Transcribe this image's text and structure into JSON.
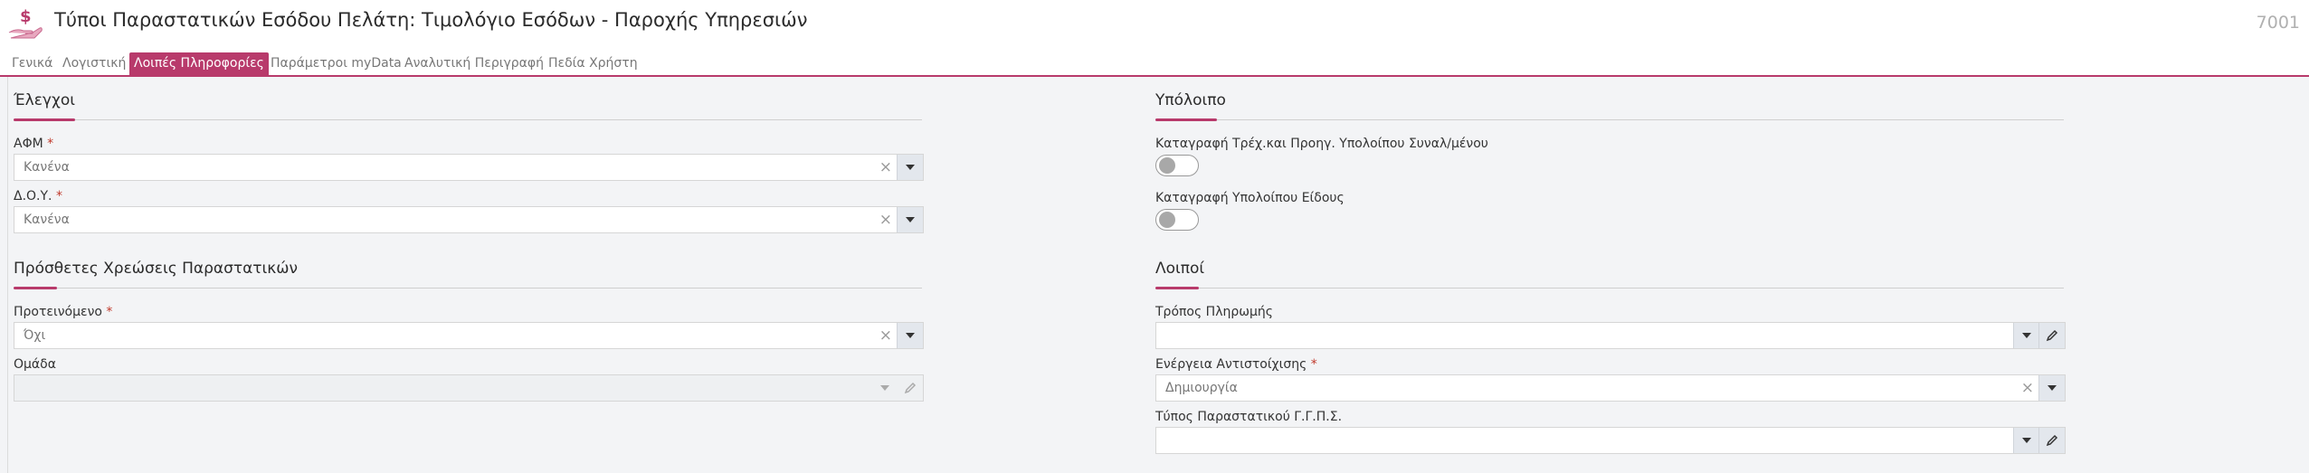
{
  "header": {
    "title": "Τύποι Παραστατικών Εσόδου Πελάτη: Τιμολόγιο Εσόδων - Παροχής Υπηρεσιών",
    "code": "7001",
    "icon": "hand-holding-dollar-icon"
  },
  "tabs": [
    {
      "label": "Γενικά",
      "active": false
    },
    {
      "label": "Λογιστική",
      "active": false
    },
    {
      "label": "Λοιπές Πληροφορίες",
      "active": true
    },
    {
      "label": "Παράμετροι myData",
      "active": false
    },
    {
      "label": "Αναλυτική Περιγραφή",
      "active": false
    },
    {
      "label": "Πεδία Χρήστη",
      "active": false
    }
  ],
  "left": {
    "checks": {
      "title": "Έλεγχοι",
      "afm": {
        "label": "ΑΦΜ",
        "required": "*",
        "value": "Κανένα"
      },
      "doy": {
        "label": "Δ.Ο.Υ.",
        "required": "*",
        "value": "Κανένα"
      }
    },
    "charges": {
      "title": "Πρόσθετες Χρεώσεις Παραστατικών",
      "suggested": {
        "label": "Προτεινόμενο",
        "required": "*",
        "value": "Όχι"
      },
      "group": {
        "label": "Ομάδα",
        "value": ""
      }
    }
  },
  "right": {
    "balance": {
      "title": "Υπόλοιπο",
      "toggle1": {
        "label": "Καταγραφή Τρέχ.και Προηγ. Υπολοίπου Συναλ/μένου",
        "on": false
      },
      "toggle2": {
        "label": "Καταγραφή Υπολοίπου Είδους",
        "on": false
      }
    },
    "other": {
      "title": "Λοιποί",
      "payment": {
        "label": "Τρόπος Πληρωμής",
        "value": ""
      },
      "action": {
        "label": "Ενέργεια Αντιστοίχισης",
        "required": "*",
        "value": "Δημιουργία"
      },
      "ggps": {
        "label": "Τύπος Παραστατικού Γ.Γ.Π.Σ.",
        "value": ""
      }
    }
  },
  "colors": {
    "accent": "#b83a6b",
    "required": "#c0392b"
  }
}
